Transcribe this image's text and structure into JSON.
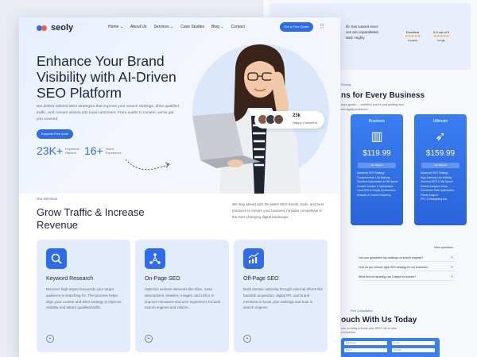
{
  "back": {
    "proof_text": [
      "ific has soared since",
      "ces are unparalleled.",
      "sted. Highly"
    ],
    "rating1": {
      "label": "Excellent",
      "brand": "Trustpilot"
    },
    "rating2": {
      "label": "4.8 out of 5",
      "brand": "Google"
    },
    "pricing_sub": "Pricing",
    "pricing_title": "ns for Every Business",
    "pricing_desc": [
      "your goals — whether you're just getting star",
      "ed digital presence."
    ],
    "plans": [
      {
        "name": "Business",
        "price": "$119.99",
        "button": "Get Started",
        "features": [
          "Advanced SEO Strategy",
          "Comprehensive Link Building",
          "Technical Optimization & Site Speed",
          "Content Creation & Optimization",
          "Local SEO & Google My Business",
          "Analytics & Custom Reporting"
        ]
      },
      {
        "name": "Ultimate",
        "price": "$159.99",
        "button": "Get Started",
        "features": [
          "Advanced SEO Strategy",
          "High-Authority Link Building",
          "Technical SEO & Site Speed",
          "Custom Analytics Setup",
          "Conversion Rate Optimization",
          "Priority Support",
          "PPC & Retargeting Ads"
        ]
      }
    ],
    "faq_header": "Have questions",
    "faqs": [
      "Can you guarantee top rankings on search engines?",
      "How do you choose right SEO strategy for my business?",
      "What kind of reporting can I expect to receive?"
    ],
    "contact_sub": "Free Consultation",
    "contact_title": "ouch With Us Today",
    "contact_desc": [
      "ons, or ready to boost your SEO? We're here",
      "ur business."
    ],
    "form_fields": [
      "Full Name",
      "Email",
      "Phone",
      "Website"
    ]
  },
  "logo": {
    "text": "seoly"
  },
  "nav": [
    "Home ⌄",
    "About Us",
    "Services ⌄",
    "Case Studies",
    "Blog ⌄",
    "Contact"
  ],
  "cta": "Get a Free Quote",
  "hero": {
    "title": "Enhance Your Brand Visibility with AI-Driven SEO Platform",
    "desc": "We deliver tailored SEO strategies that improve your search rankings, drive qualified traffic, and convert visitors into loyal customers. From audits to content, we've got you covered.",
    "button": "Request Free Audit",
    "stats": [
      {
        "num": "23K+",
        "label1": "Keywords",
        "label2": "Ranked"
      },
      {
        "num": "16+",
        "label1": "Years",
        "label2": "Experience"
      }
    ],
    "badge_num": "23k",
    "badge_cap": "Happy Cusomers"
  },
  "services": {
    "sub": "Our Services",
    "title": "Grow Traffic & Increase Revenue",
    "desc": "We stay ahead with the latest SEO trends, tools, and best practices to ensure your business remains competitive in the ever-changing digital landscape",
    "cards": [
      {
        "title": "Keyword Research",
        "desc": "Discover high-impact keywords your target audience is searching for. This process helps align your content and SEO strategy to improve visibility and attract qualified traffic."
      },
      {
        "title": "On-Page SEO",
        "desc": "Optimize website elements like titles, meta descriptions, headers, images, and URLs to improve relevance and user experience for both search engines and visitors."
      },
      {
        "title": "Off-Page SEO",
        "desc": "Build domain authority through external efforts like backlink acquisition, digital PR, and brand mentions to boost your rankings and trust in search engines."
      }
    ]
  },
  "colors": {
    "accent": "#2f6bea",
    "card_bg": "#e3ecfb"
  }
}
